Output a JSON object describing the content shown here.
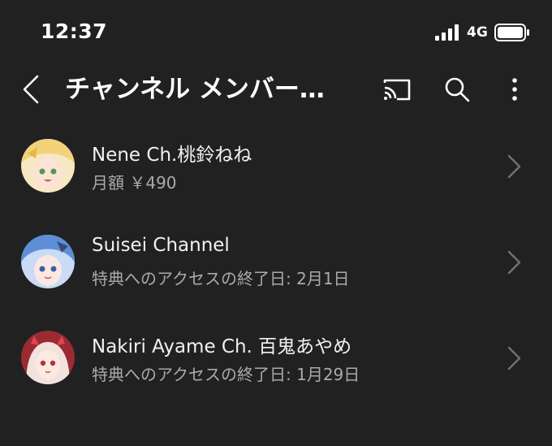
{
  "status_bar": {
    "time": "12:37",
    "network": "4G"
  },
  "header": {
    "title": "チャンネル メンバー…",
    "icons": [
      "back-arrow-icon",
      "cast-icon",
      "search-icon",
      "more-vert-icon"
    ]
  },
  "memberships": [
    {
      "name": "Nene Ch.桃鈴ねね",
      "detail": "月額 ￥490",
      "avatar_colors": [
        "#f4d27a",
        "#f7e7c4"
      ]
    },
    {
      "name": "Suisei Channel",
      "detail": "特典へのアクセスの終了日: 2月1日",
      "avatar_colors": [
        "#5d8fd6",
        "#c9dbf5"
      ]
    },
    {
      "name": "Nakiri Ayame Ch. 百鬼あやめ",
      "detail": "特典へのアクセスの終了日: 1月29日",
      "avatar_colors": [
        "#9b2a33",
        "#f2e2de"
      ]
    }
  ],
  "colors": {
    "background": "#212121",
    "primary_text": "#f1f1f1",
    "secondary_text": "#aaaaaa",
    "chevron": "#717171"
  }
}
